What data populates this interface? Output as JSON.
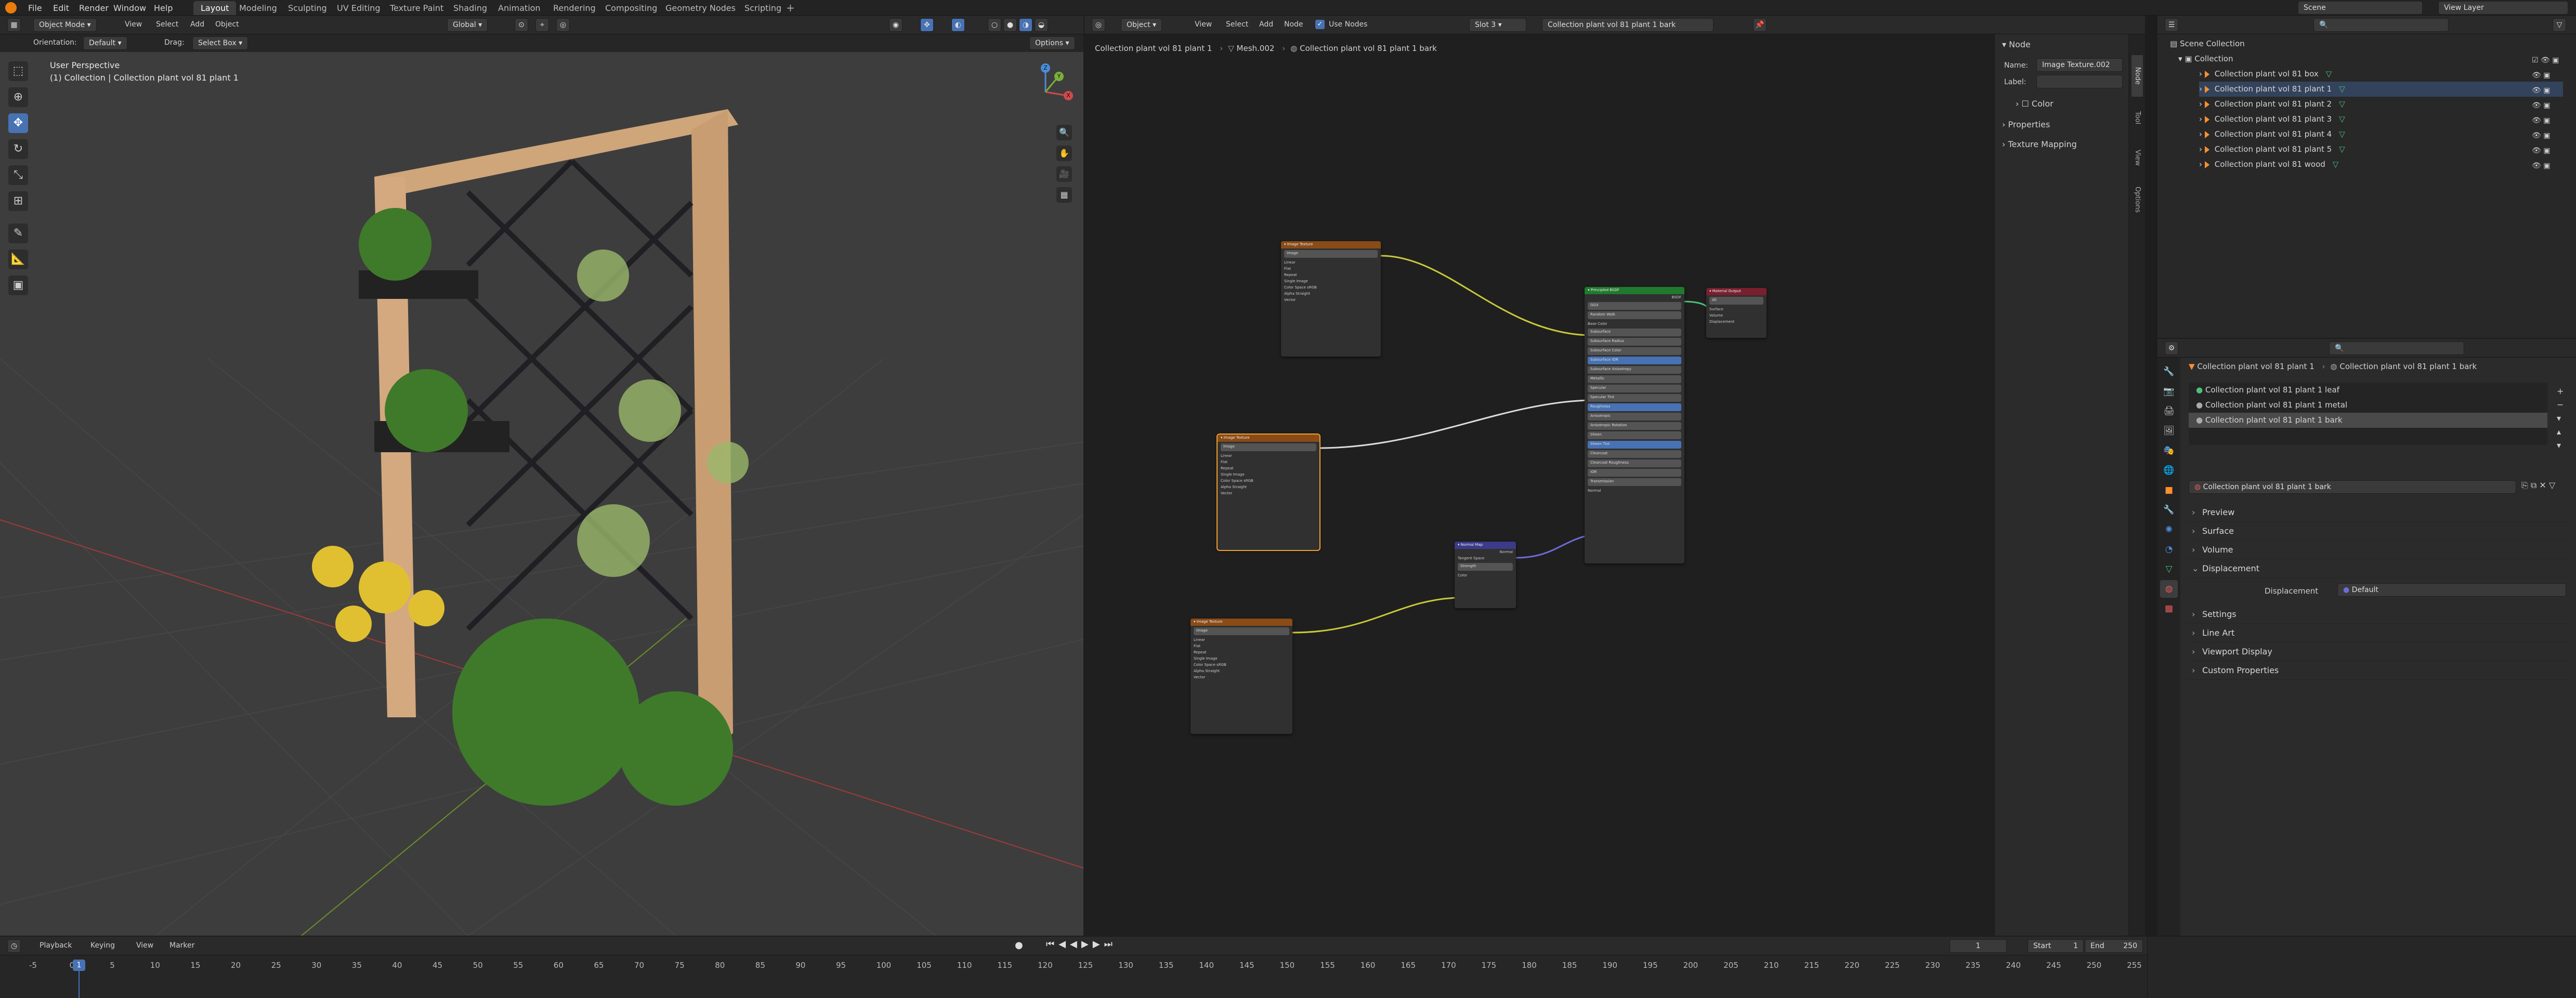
{
  "menus": [
    "File",
    "Edit",
    "Render",
    "Window",
    "Help"
  ],
  "workspaces": [
    {
      "label": "Layout",
      "active": true
    },
    {
      "label": "Modeling"
    },
    {
      "label": "Sculpting"
    },
    {
      "label": "UV Editing"
    },
    {
      "label": "Texture Paint"
    },
    {
      "label": "Shading"
    },
    {
      "label": "Animation"
    },
    {
      "label": "Rendering"
    },
    {
      "label": "Compositing"
    },
    {
      "label": "Geometry Nodes"
    },
    {
      "label": "Scripting"
    }
  ],
  "scene": "Scene",
  "view_layer": "View Layer",
  "viewport": {
    "mode": "Object Mode",
    "menus": [
      "View",
      "Select",
      "Add",
      "Object"
    ],
    "transform": "Global",
    "orientation_label": "Orientation:",
    "orientation": "Default",
    "drag_label": "Drag:",
    "drag": "Select Box",
    "options": "Options",
    "overlay_title": "User Perspective",
    "overlay_sub": "(1) Collection | Collection plant vol 81 plant 1",
    "gizmo_x": "X",
    "gizmo_y": "Y",
    "gizmo_z": "Z"
  },
  "node_editor": {
    "type": "Object",
    "menus": [
      "View",
      "Select",
      "Add",
      "Node"
    ],
    "use_nodes": "Use Nodes",
    "slot": "Slot 3",
    "material": "Collection plant vol 81 plant 1 bark",
    "breadcrumb": [
      "Collection plant vol 81 plant 1",
      "Mesh.002",
      "Collection plant vol 81 plant 1 bark"
    ],
    "sidebar": {
      "section": "Node",
      "name_label": "Name:",
      "name_value": "Image Texture.002",
      "label_label": "Label:",
      "color": "Color",
      "properties": "Properties",
      "texture_mapping": "Texture Mapping"
    },
    "side_tabs": [
      "Node",
      "Tool",
      "View",
      "Options"
    ]
  },
  "outliner": {
    "search": "",
    "root": "Scene Collection",
    "collection": "Collection",
    "items": [
      "Collection plant vol 81 box",
      "Collection plant vol 81 plant 1",
      "Collection plant vol 81 plant 2",
      "Collection plant vol 81 plant 3",
      "Collection plant vol 81 plant 4",
      "Collection plant vol 81 plant 5",
      "Collection plant vol 81 wood"
    ]
  },
  "properties": {
    "breadcrumb_obj": "Collection plant vol 81 plant 1",
    "breadcrumb_mat": "Collection plant vol 81 plant 1 bark",
    "slots": [
      "Collection plant vol 81 plant 1 leaf",
      "Collection plant vol 81 plant 1 metal",
      "Collection plant vol 81 plant 1 bark"
    ],
    "material": "Collection plant vol 81 plant 1 bark",
    "sections": [
      "Preview",
      "Surface",
      "Volume"
    ],
    "displacement_section": "Displacement",
    "displacement_label": "Displacement",
    "displacement_value": "Default",
    "sections_after": [
      "Settings",
      "Line Art",
      "Viewport Display",
      "Custom Properties"
    ]
  },
  "timeline": {
    "menus": [
      "Playback",
      "Keying",
      "View",
      "Marker"
    ],
    "current_frame": "1",
    "start_label": "Start",
    "start": "1",
    "end_label": "End",
    "end": "250",
    "playhead": "1",
    "ticks": [
      "-5",
      "0",
      "5",
      "10",
      "15",
      "20",
      "25",
      "30",
      "35",
      "40",
      "45",
      "50",
      "55",
      "60",
      "65",
      "70",
      "75",
      "80",
      "85",
      "90",
      "95",
      "100",
      "105",
      "110",
      "115",
      "120",
      "125",
      "130",
      "135",
      "140",
      "145",
      "150",
      "155",
      "160",
      "165",
      "170",
      "175",
      "180",
      "185",
      "190",
      "195",
      "200",
      "205",
      "210",
      "215",
      "220",
      "225",
      "230",
      "235",
      "240",
      "245",
      "250",
      "255"
    ]
  },
  "colors": {
    "accent": "#4772b3",
    "node_texture": "#8a4b17",
    "node_bsdf": "#1f7a2e",
    "node_output": "#7a1f2e",
    "node_normal": "#3b3b8a",
    "wire_yellow": "#c9c93a",
    "wire_blue": "#6c6cd8"
  }
}
